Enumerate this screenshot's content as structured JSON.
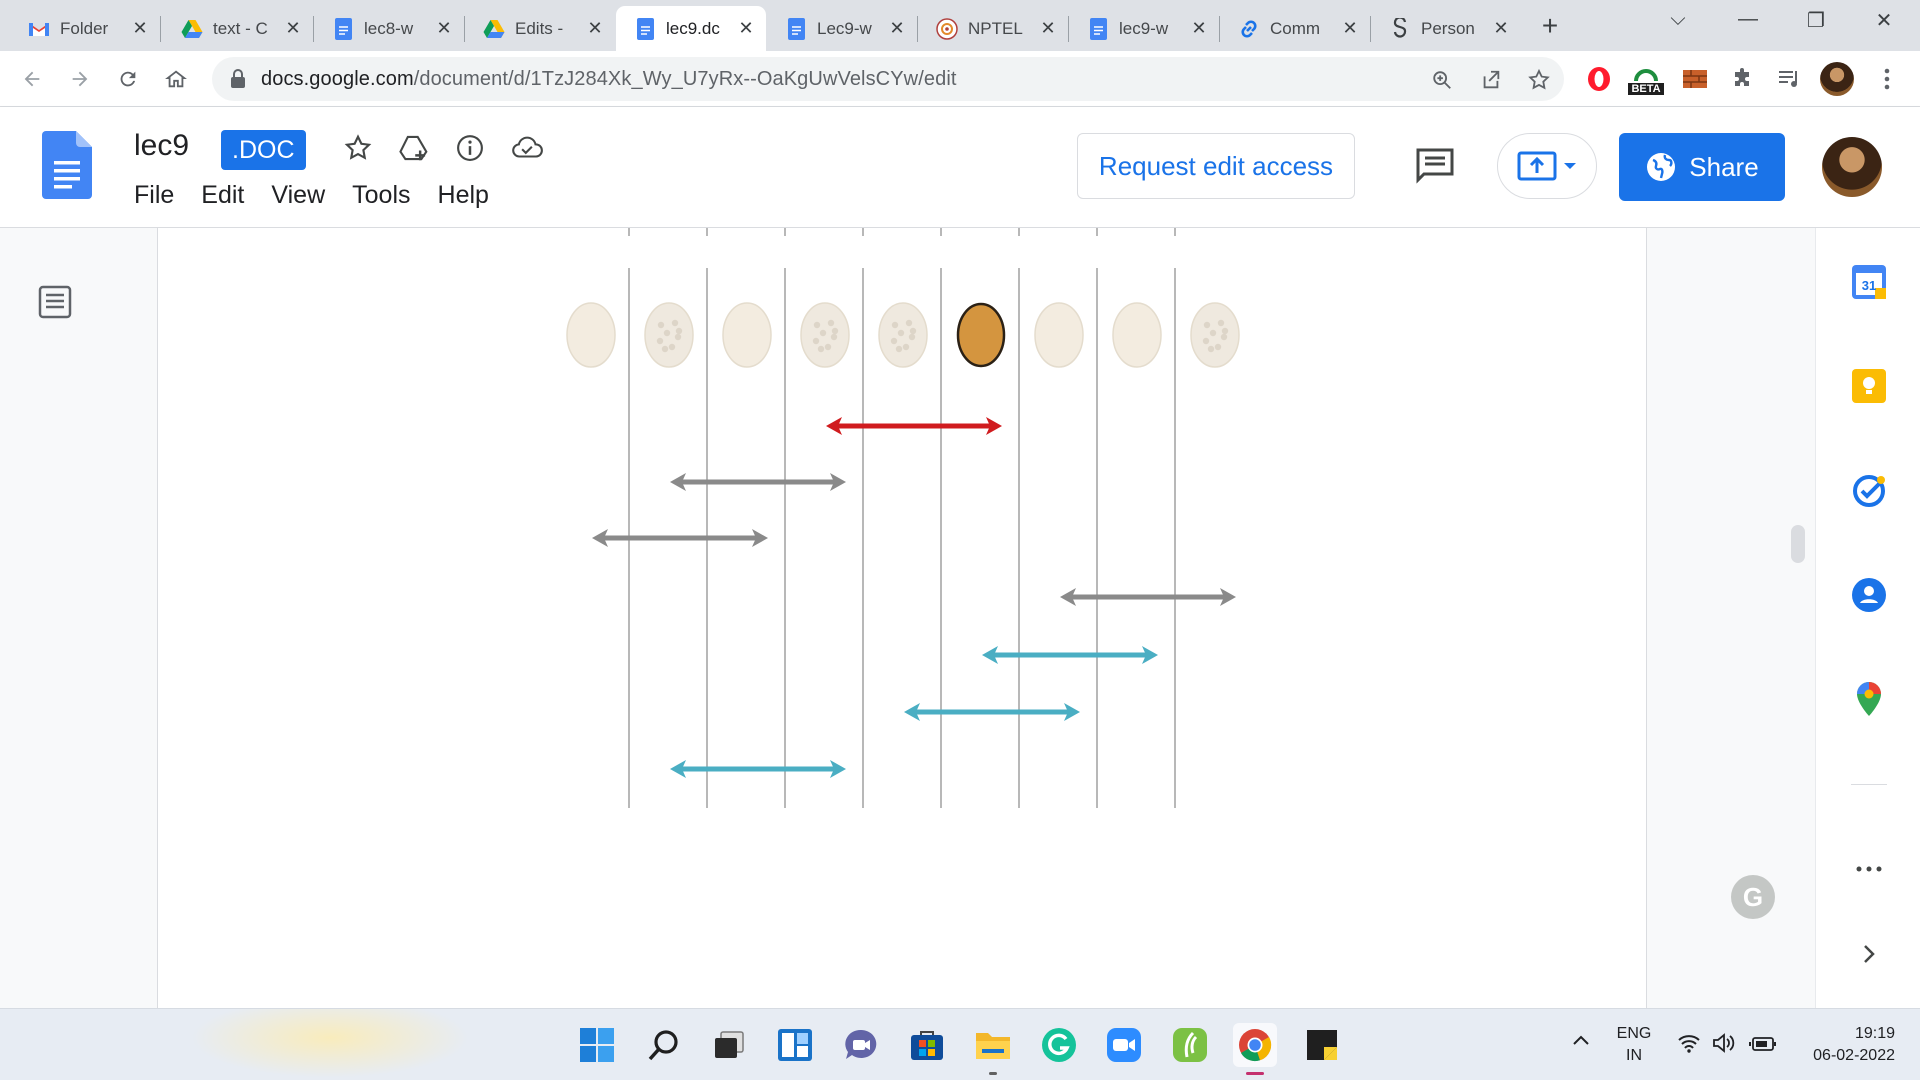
{
  "browser": {
    "tabs": [
      {
        "title": "Folder",
        "icon": "gmail-icon"
      },
      {
        "title": "text - C",
        "icon": "drive-icon"
      },
      {
        "title": "lec8-w",
        "icon": "docs-icon"
      },
      {
        "title": "Edits -",
        "icon": "drive-icon"
      },
      {
        "title": "lec9.dc",
        "icon": "docs-icon",
        "active": true
      },
      {
        "title": "Lec9-w",
        "icon": "docs-icon"
      },
      {
        "title": "NPTEL",
        "icon": "nptel-icon"
      },
      {
        "title": "lec9-w",
        "icon": "docs-icon"
      },
      {
        "title": "Comm",
        "icon": "link-icon"
      },
      {
        "title": "Person",
        "icon": "person-link-icon"
      }
    ],
    "new_tab_label": "+",
    "url_host": "docs.google.com",
    "url_path": "/document/d/1TzJ284Xk_Wy_U7yRx--OaKgUwVelsCYw/edit",
    "extension_badge": "BETA"
  },
  "docs": {
    "title": "lec9",
    "badge": ".DOC",
    "menu": [
      "File",
      "Edit",
      "View",
      "Tools",
      "Help"
    ],
    "request_edit_label": "Request edit access",
    "share_label": "Share"
  },
  "diagram": {
    "column_count": 9,
    "highlighted_index": 5,
    "colors": {
      "plain_oval": "#f3ece0",
      "dotted_oval": "#efe9df",
      "highlight_oval": "#d4953f",
      "red_arrow": "#d01c1f",
      "gray_arrow": "#8a8a8a",
      "teal_arrow": "#4aaec3",
      "grid_line": "#b8b8b8"
    },
    "oval_styles": [
      "plain",
      "dotted",
      "plain",
      "dotted",
      "dotted",
      "highlight",
      "plain",
      "plain",
      "dotted"
    ]
  },
  "side_panel": {
    "icons": [
      "calendar-icon",
      "keep-icon",
      "tasks-icon",
      "contacts-icon",
      "maps-icon",
      "more-icon",
      "expand-icon"
    ],
    "calendar_day": "31"
  },
  "taskbar": {
    "apps": [
      "start-icon",
      "search-icon",
      "task-view-icon",
      "widgets-icon",
      "teams-chat-icon",
      "store-icon",
      "file-explorer-icon",
      "grammarly-icon",
      "zoom-icon",
      "app-green-icon",
      "chrome-icon",
      "sticky-notes-icon"
    ],
    "lang_top": "ENG",
    "lang_bottom": "IN",
    "time": "19:19",
    "date": "06-02-2022"
  }
}
